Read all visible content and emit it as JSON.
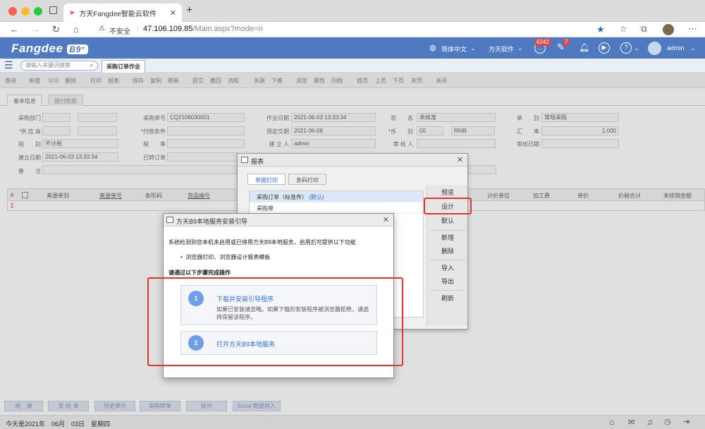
{
  "browser": {
    "tab_title": "方天Fangdee智能云软件",
    "new_tab": "+",
    "security": "不安全",
    "url_host": "47.106.109.85",
    "url_path": "/Main.aspx?mode=n"
  },
  "header": {
    "logo": "Fangdee",
    "logo_badge": "B9⁺",
    "language": "简体中文",
    "company": "方天软件",
    "messages_count": "6242",
    "edit_count": "7",
    "user": "admin",
    "brand_color": "#4f7ac1"
  },
  "nav": {
    "search_placeholder": "请输入关键词搜索",
    "page_tab": "采购订单作业"
  },
  "toolbar": [
    "查询",
    "新增",
    "编辑",
    "删除",
    "打印",
    "报表",
    "保存",
    "复制",
    "刷新",
    "提交",
    "撤回",
    "流程",
    "关联",
    "下推",
    "浏览",
    "属性",
    "归档",
    "首页",
    "上页",
    "下页",
    "末页",
    "关闭"
  ],
  "form_tabs": [
    "基本信息",
    "预付账款"
  ],
  "form": {
    "dept_label": "采购部门",
    "supplier_label": "*供 应 商",
    "tax_label": "税　　别",
    "tax_value": "不计税",
    "created_label": "建立日期",
    "created_value": "2021-06-03 13:33:34",
    "remark_label": "备　　注",
    "order_no_label": "采购单号",
    "order_no_value": "CQ2106030001",
    "pay_label": "*付款条件",
    "rate_label": "税　　率",
    "converted_label": "已转订单",
    "work_date_label": "作业日期",
    "work_date_value": "2021-06-03 13:33:34",
    "delivery_label": "预定交期",
    "delivery_value": "2021-06-08",
    "creator_label": "建 立 人",
    "creator_value": "admin",
    "status_label": "状　　态",
    "status_value": "未核准",
    "currency_label": "*币　　别",
    "currency_code": "00",
    "currency_name": "RMB",
    "approver_label": "审 核 人",
    "type_label": "单　　别",
    "type_value": "常规采购",
    "exchange_label": "汇　　率",
    "exchange_value": "1.000",
    "approve_date_label": "审核日期"
  },
  "grid": {
    "columns_left": [
      "来源单别",
      "来源单号",
      "条形码",
      "货品编号"
    ],
    "columns_right": [
      "计价单位",
      "加工费",
      "单价",
      "价税合计",
      "未核销金额"
    ],
    "row_marker": "Σ"
  },
  "bottom_buttons": [
    "结　清",
    "反 结 清",
    "历史单价",
    "采购转单",
    "拆分",
    "Excel 数据导入"
  ],
  "status_bar": {
    "date_text": "今天是2021年　06月　03日　星期四"
  },
  "report_dialog": {
    "title": "报表",
    "tabs": [
      "单据打印",
      "条码打印"
    ],
    "items": [
      {
        "name": "采购订单（标准件）",
        "tag": "(默认)"
      },
      {
        "name": "采购单",
        "tag": ""
      }
    ],
    "buttons": [
      "预览",
      "设计",
      "默认",
      "新增",
      "删除",
      "导入",
      "导出",
      "刷新"
    ]
  },
  "install_dialog": {
    "title": "方天B9本地服务安装引导",
    "intro": "系统检测到您本机未启用或已停用方天B9本地服务，启用后可提供以下功能",
    "feature": "浏览器打印、浏览器设计报表模板",
    "prompt": "请通过以下步骤完成操作",
    "step1_num": "1",
    "step1_title": "下载并安装引导程序",
    "step1_desc": "如果已安装请忽略。如果下载的安装程序被浏览器拒绝，请选择保留该程序。",
    "step2_num": "2",
    "step2_title": "打开方天B9本地服务"
  }
}
